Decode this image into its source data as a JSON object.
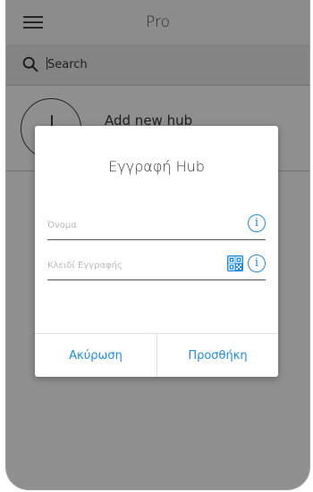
{
  "header": {
    "title": "Pro"
  },
  "search": {
    "placeholder": "Search"
  },
  "hub_list": {
    "add_label": "Add new hub"
  },
  "dialog": {
    "title": "Εγγραφή Hub",
    "name_field": {
      "placeholder": "Όνομα",
      "value": ""
    },
    "key_field": {
      "placeholder": "Κλειδί Εγγραφής",
      "value": ""
    },
    "info_symbol": "i",
    "cancel_label": "Ακύρωση",
    "add_label": "Προσθήκη"
  },
  "colors": {
    "accent": "#1e8de0",
    "background": "#e7e7e7",
    "overlay": "rgba(0,0,0,0.38)"
  },
  "icons": {
    "menu": "hamburger-icon",
    "search": "search-icon",
    "add": "add-circle-icon",
    "info": "info-icon",
    "qr": "qr-code-icon"
  }
}
